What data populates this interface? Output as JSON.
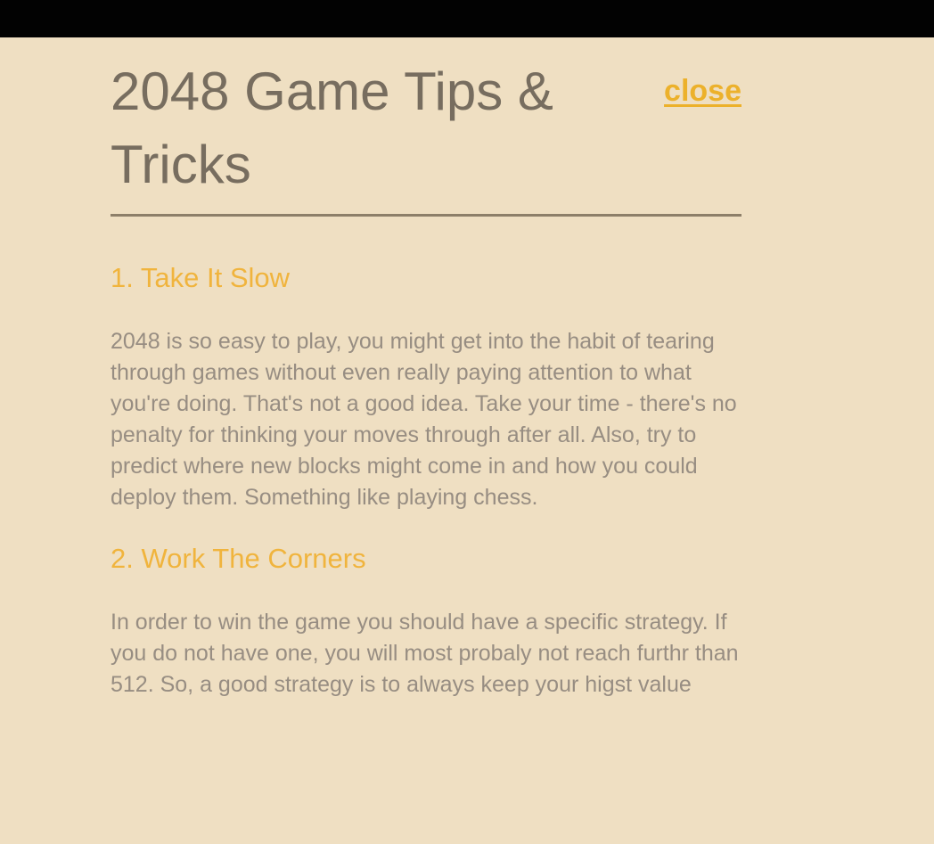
{
  "page": {
    "title": "2048 Game Tips & Tricks",
    "close_label": "close"
  },
  "sections": [
    {
      "title": "1. Take It Slow",
      "text": "2048 is so easy to play, you might get into the habit of tearing through games without even really paying attention to what you're doing. That's not a good idea. Take your time - there's no penalty for thinking your moves through after all. Also, try to predict where new blocks might come in and how you could deploy them. Something like playing chess."
    },
    {
      "title": "2. Work The Corners",
      "text": "In order to win the game you should have a specific strategy. If you do not have one, you will most probaly not reach furthr than 512. So, a good strategy is to always keep your higst value"
    }
  ],
  "colors": {
    "top_bar": "#020202",
    "background": "#efdfc2",
    "title": "#776d5f",
    "accent": "#ecb12b",
    "body_text": "#978d82",
    "rule": "#8d7f69"
  }
}
